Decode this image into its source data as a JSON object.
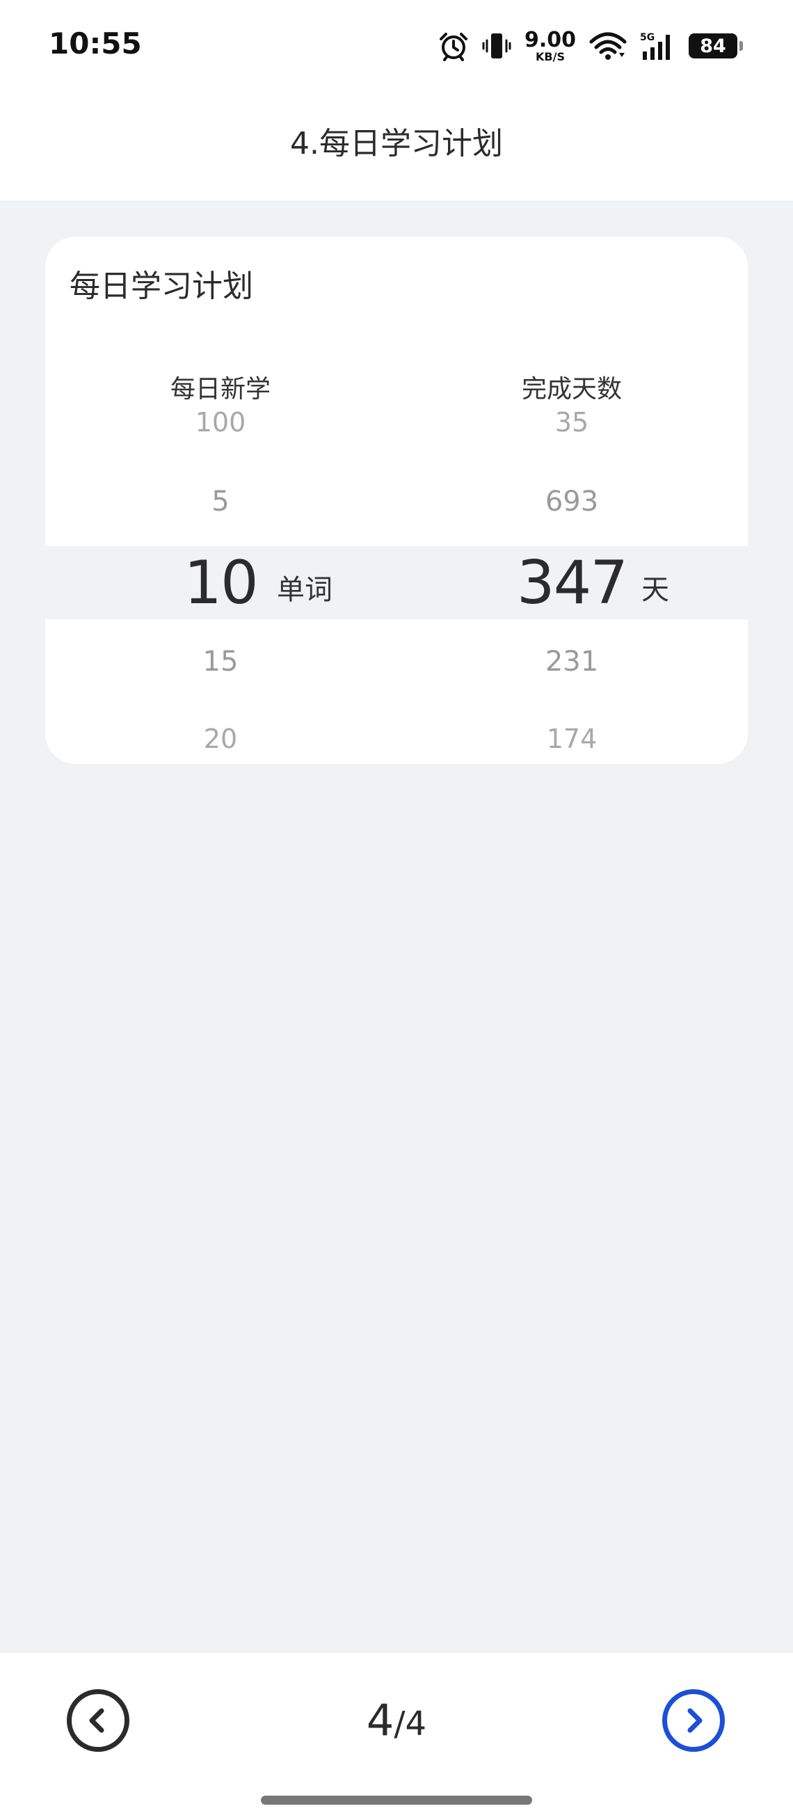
{
  "status_bar": {
    "time": "10:55",
    "net_speed_value": "9.00",
    "net_speed_unit": "KB/S",
    "cell_label": "5G",
    "battery": "84",
    "icons": [
      "alarm-icon",
      "vibrate-icon",
      "wifi-icon",
      "cell-signal-icon",
      "battery-icon"
    ]
  },
  "header": {
    "title": "4.每日学习计划"
  },
  "card": {
    "title": "每日学习计划",
    "left_column": {
      "label": "每日新学",
      "items_above": [
        "100",
        "5"
      ],
      "selected": "10",
      "unit": "单词",
      "items_below": [
        "15",
        "20"
      ]
    },
    "right_column": {
      "label": "完成天数",
      "items_above": [
        "35",
        "693"
      ],
      "selected": "347",
      "unit": "天",
      "items_below": [
        "231",
        "174"
      ]
    }
  },
  "footer": {
    "current_page": "4",
    "separator": "/",
    "total_pages": "4",
    "prev_icon": "chevron-left-circle-icon",
    "next_icon": "chevron-right-circle-icon",
    "next_color": "#1c4fd8"
  }
}
